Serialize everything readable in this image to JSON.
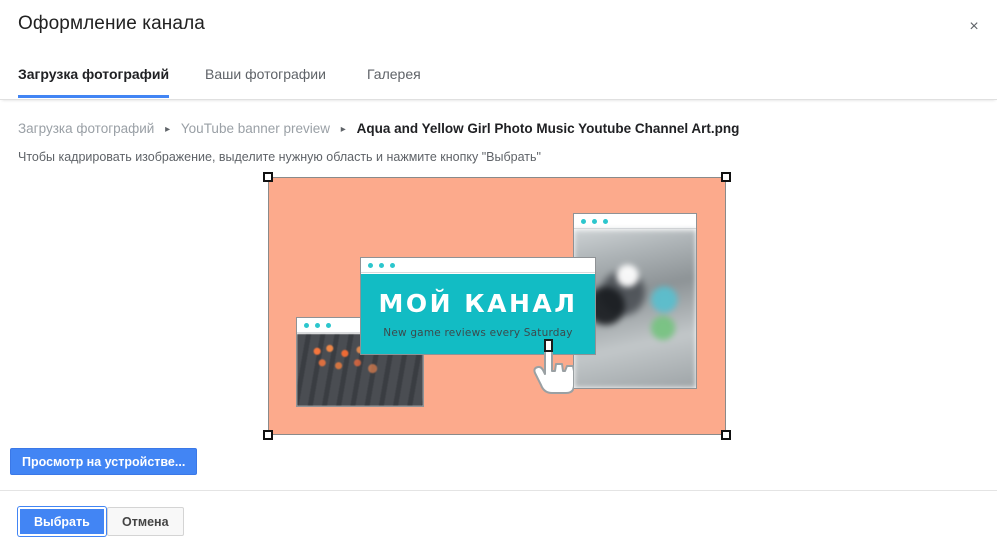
{
  "dialog": {
    "title": "Оформление канала",
    "close_label": "×"
  },
  "tabs": [
    {
      "label": "Загрузка фотографий",
      "active": true
    },
    {
      "label": "Ваши фотографии",
      "active": false
    },
    {
      "label": "Галерея",
      "active": false
    }
  ],
  "breadcrumb": {
    "separator": "▸",
    "items": [
      {
        "label": "Загрузка фотографий",
        "current": false
      },
      {
        "label": "YouTube banner preview",
        "current": false
      },
      {
        "label": "Aqua and Yellow Girl Photo Music Youtube Channel Art.png",
        "current": true
      }
    ]
  },
  "crop_hint": "Чтобы кадрировать изображение, выделите нужную область и нажмите кнопку \"Выбрать\"",
  "banner": {
    "background_color": "#fcaa8c",
    "accent_color": "#12bcc4",
    "title": "Мой канал",
    "subtitle": "New game reviews every Saturday",
    "windows": [
      {
        "name": "keyboard-window",
        "content": "backlit gaming keyboard photo"
      },
      {
        "name": "controller-window",
        "content": "blurred game controller photo"
      },
      {
        "name": "title-window",
        "content": "channel title card"
      }
    ],
    "cursor": "pointing-hand"
  },
  "crop": {
    "handles": [
      "top-left",
      "top-right",
      "bottom-left",
      "bottom-right"
    ]
  },
  "buttons": {
    "device_preview": "Просмотр на устройстве...",
    "confirm": "Выбрать",
    "cancel": "Отмена"
  },
  "colors": {
    "accent_blue": "#4285f4",
    "banner_peach": "#fcaa8c",
    "banner_teal": "#12bcc4"
  }
}
